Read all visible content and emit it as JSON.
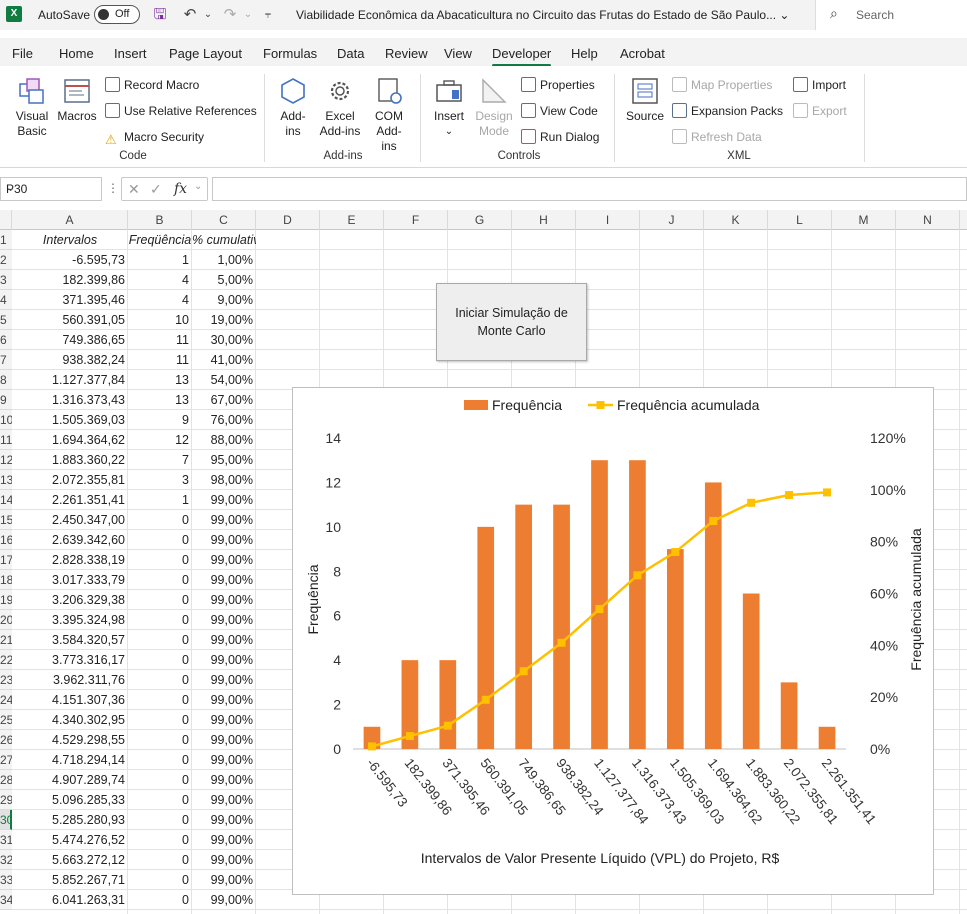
{
  "titlebar": {
    "app_icon": "excel-logo",
    "autosave_label": "AutoSave",
    "autosave_state": "Off",
    "doc_title": "Viabilidade Econômica da Abacaticultura no Circuito das Frutas do Estado de São Paulo... ⌄",
    "search_placeholder": "Search"
  },
  "menu": {
    "tabs": [
      "File",
      "Home",
      "Insert",
      "Page Layout",
      "Formulas",
      "Data",
      "Review",
      "View",
      "Developer",
      "Help",
      "Acrobat"
    ],
    "active": "Developer"
  },
  "ribbon": {
    "code": {
      "label": "Code",
      "visual_basic": "Visual Basic",
      "macros": "Macros",
      "record_macro": "Record Macro",
      "use_relative": "Use Relative References",
      "macro_security": "Macro Security"
    },
    "addins": {
      "label": "Add-ins",
      "addins": "Add-ins",
      "excel_addins": "Excel Add-ins",
      "com_addins": "COM Add-ins"
    },
    "controls": {
      "label": "Controls",
      "insert": "Insert",
      "design_mode": "Design Mode",
      "properties": "Properties",
      "view_code": "View Code",
      "run_dialog": "Run Dialog"
    },
    "xml": {
      "label": "XML",
      "source": "Source",
      "map_properties": "Map Properties",
      "expansion_packs": "Expansion Packs",
      "refresh_data": "Refresh Data",
      "import": "Import",
      "export": "Export"
    }
  },
  "formula_bar": {
    "name_box": "P30",
    "value": ""
  },
  "sheet": {
    "columns": [
      "A",
      "B",
      "C",
      "D",
      "E",
      "F",
      "G",
      "H",
      "I",
      "J",
      "K",
      "L",
      "M",
      "N"
    ],
    "selected_row": 30,
    "headers": [
      "Intervalos",
      "Freqüência",
      "% cumulativo"
    ],
    "rows": [
      [
        "-6.595,73",
        "1",
        "1,00%"
      ],
      [
        "182.399,86",
        "4",
        "5,00%"
      ],
      [
        "371.395,46",
        "4",
        "9,00%"
      ],
      [
        "560.391,05",
        "10",
        "19,00%"
      ],
      [
        "749.386,65",
        "11",
        "30,00%"
      ],
      [
        "938.382,24",
        "11",
        "41,00%"
      ],
      [
        "1.127.377,84",
        "13",
        "54,00%"
      ],
      [
        "1.316.373,43",
        "13",
        "67,00%"
      ],
      [
        "1.505.369,03",
        "9",
        "76,00%"
      ],
      [
        "1.694.364,62",
        "12",
        "88,00%"
      ],
      [
        "1.883.360,22",
        "7",
        "95,00%"
      ],
      [
        "2.072.355,81",
        "3",
        "98,00%"
      ],
      [
        "2.261.351,41",
        "1",
        "99,00%"
      ],
      [
        "2.450.347,00",
        "0",
        "99,00%"
      ],
      [
        "2.639.342,60",
        "0",
        "99,00%"
      ],
      [
        "2.828.338,19",
        "0",
        "99,00%"
      ],
      [
        "3.017.333,79",
        "0",
        "99,00%"
      ],
      [
        "3.206.329,38",
        "0",
        "99,00%"
      ],
      [
        "3.395.324,98",
        "0",
        "99,00%"
      ],
      [
        "3.584.320,57",
        "0",
        "99,00%"
      ],
      [
        "3.773.316,17",
        "0",
        "99,00%"
      ],
      [
        "3.962.311,76",
        "0",
        "99,00%"
      ],
      [
        "4.151.307,36",
        "0",
        "99,00%"
      ],
      [
        "4.340.302,95",
        "0",
        "99,00%"
      ],
      [
        "4.529.298,55",
        "0",
        "99,00%"
      ],
      [
        "4.718.294,14",
        "0",
        "99,00%"
      ],
      [
        "4.907.289,74",
        "0",
        "99,00%"
      ],
      [
        "5.096.285,33",
        "0",
        "99,00%"
      ],
      [
        "5.285.280,93",
        "0",
        "99,00%"
      ],
      [
        "5.474.276,52",
        "0",
        "99,00%"
      ],
      [
        "5.663.272,12",
        "0",
        "99,00%"
      ],
      [
        "5.852.267,71",
        "0",
        "99,00%"
      ],
      [
        "6.041.263,31",
        "0",
        "99,00%"
      ]
    ],
    "button_label": "Iniciar Simulação de Monte Carlo"
  },
  "chart_data": {
    "type": "bar",
    "categories": [
      "-6.595,73",
      "182.399,86",
      "371.395,46",
      "560.391,05",
      "749.386,65",
      "938.382,24",
      "1.127.377,84",
      "1.316.373,43",
      "1.505.369,03",
      "1.694.364,62",
      "1.883.360,22",
      "2.072.355,81",
      "2.261.351,41"
    ],
    "series": [
      {
        "name": "Frequência",
        "type": "bar",
        "axis": "left",
        "color": "#ed7d31",
        "values": [
          1,
          4,
          4,
          10,
          11,
          11,
          13,
          13,
          9,
          12,
          7,
          3,
          1
        ]
      },
      {
        "name": "Frequência acumulada",
        "type": "line",
        "axis": "right",
        "color": "#ffc000",
        "values": [
          1,
          5,
          9,
          19,
          30,
          41,
          54,
          67,
          76,
          88,
          95,
          98,
          99
        ]
      }
    ],
    "xlabel": "Intervalos de Valor Presente Líquido (VPL) do Projeto, R$",
    "ylabel": "Frequência",
    "y2label": "Frequência acumulada",
    "ylim": [
      0,
      14
    ],
    "y_ticks": [
      0,
      2,
      4,
      6,
      8,
      10,
      12,
      14
    ],
    "y2lim": [
      0,
      120
    ],
    "y2_ticks": [
      "0%",
      "20%",
      "40%",
      "60%",
      "80%",
      "100%",
      "120%"
    ],
    "legend": "top",
    "grid": false
  }
}
